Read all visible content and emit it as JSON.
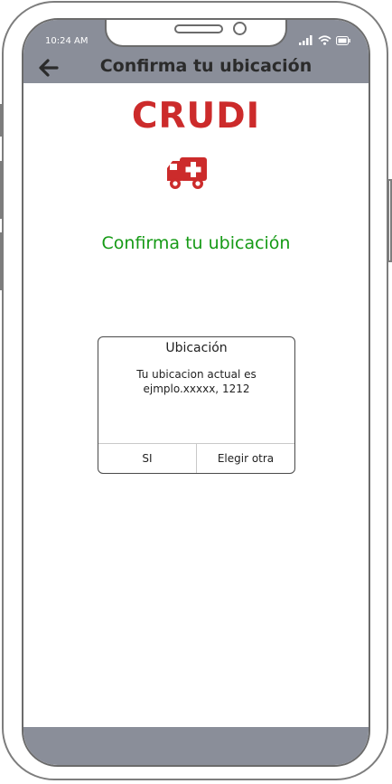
{
  "status_bar": {
    "time": "10:24 AM"
  },
  "header": {
    "title": "Confirma tu ubicación",
    "back_icon": "arrow-left-icon"
  },
  "brand": {
    "name": "CRUDI",
    "icon": "ambulance-icon",
    "color": "#cc2b2b"
  },
  "subtitle": {
    "text": "Confirma tu ubicación",
    "color": "#159a15"
  },
  "dialog": {
    "title": "Ubicación",
    "message_line1": "Tu ubicacion actual es",
    "message_line2": "ejmplo.xxxxx, 1212",
    "buttons": {
      "confirm": "SI",
      "other": "Elegir otra"
    }
  },
  "colors": {
    "bar": "#8a8e99"
  }
}
